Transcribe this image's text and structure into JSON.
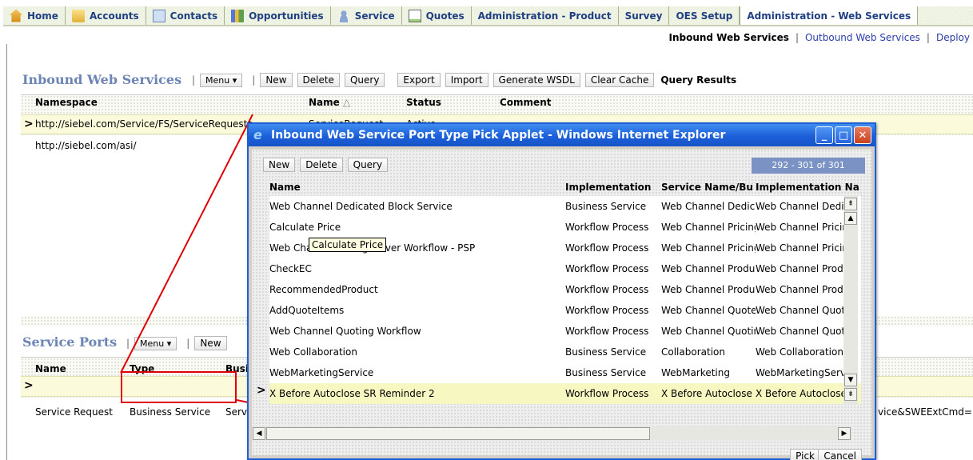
{
  "tabs": [
    {
      "label": "Home",
      "icon": "home-icon"
    },
    {
      "label": "Accounts",
      "icon": "folder-icon"
    },
    {
      "label": "Contacts",
      "icon": "contact-card-icon"
    },
    {
      "label": "Opportunities",
      "icon": "opportunities-icon"
    },
    {
      "label": "Service",
      "icon": "person-icon"
    },
    {
      "label": "Quotes",
      "icon": "document-icon"
    },
    {
      "label": "Administration - Product",
      "icon": ""
    },
    {
      "label": "Survey",
      "icon": ""
    },
    {
      "label": "OES Setup",
      "icon": ""
    },
    {
      "label": "Administration - Web Services",
      "icon": "",
      "active": true
    }
  ],
  "subnav": {
    "active": "Inbound Web Services",
    "outbound": "Outbound Web Services",
    "deploy": "Deploy"
  },
  "inbound": {
    "title": "Inbound Web Services",
    "menu": "Menu ▾",
    "buttons": {
      "new": "New",
      "delete": "Delete",
      "query": "Query",
      "export": "Export",
      "import": "Import",
      "generate": "Generate WSDL",
      "clear": "Clear Cache"
    },
    "query_results": "Query Results",
    "columns": {
      "namespace": "Namespace",
      "name": "Name",
      "status": "Status",
      "comment": "Comment"
    },
    "rows": [
      {
        "namespace": "http://siebel.com/Service/FS/ServiceRequests",
        "name": "ServiceRequest",
        "status": "Active"
      },
      {
        "namespace": "http://siebel.com/asi/",
        "name": "",
        "status": ""
      }
    ]
  },
  "ports": {
    "title": "Service Ports",
    "menu": "Menu ▾",
    "new": "New",
    "columns": {
      "name": "Name",
      "type": "Type",
      "business": "Busi"
    },
    "row": {
      "name": "Service Request",
      "type": "Business Service",
      "serv": "Serv",
      "tail": "vice&SWEExtCmd=E"
    }
  },
  "popup": {
    "title": "Inbound Web Service Port Type Pick Applet - Windows Internet Explorer",
    "buttons": {
      "new": "New",
      "delete": "Delete",
      "query": "Query",
      "pick": "Pick",
      "cancel": "Cancel"
    },
    "pager": "292 - 301 of 301",
    "columns": {
      "name": "Name",
      "implementation": "Implementation",
      "service": "Service Name/Bu",
      "impl_name": "Implementation Na"
    },
    "rows": [
      {
        "name": "Web Channel Dedicated Block Service",
        "impl": "Business Service",
        "svc": "Web Channel Dedica",
        "implname": "Web Channel Dedicate"
      },
      {
        "name": "Calculate Price",
        "impl": "Workflow Process",
        "svc": "Web Channel Pricing",
        "implname": "Web Channel Pricing D"
      },
      {
        "name": "Web Channel Pricing Driver Workflow - PSP",
        "impl": "Workflow Process",
        "svc": "Web Channel Pricing",
        "implname": "Web Channel Pricing D"
      },
      {
        "name": "CheckEC",
        "impl": "Workflow Process",
        "svc": "Web Channel Produ",
        "implname": "Web Channel Product"
      },
      {
        "name": "RecommendedProduct",
        "impl": "Workflow Process",
        "svc": "Web Channel Produ",
        "implname": "Web Channel Product"
      },
      {
        "name": "AddQuoteItems",
        "impl": "Workflow Process",
        "svc": "Web Channel Quote",
        "implname": "Web Channel Quote A"
      },
      {
        "name": "Web Channel Quoting Workflow",
        "impl": "Workflow Process",
        "svc": "Web Channel Quotir",
        "implname": "Web Channel Quoting"
      },
      {
        "name": "Web Collaboration",
        "impl": "Business Service",
        "svc": "Collaboration",
        "implname": "Web Collaboration Ser"
      },
      {
        "name": "WebMarketingService",
        "impl": "Business Service",
        "svc": "WebMarketing",
        "implname": "WebMarketingService"
      },
      {
        "name": "X Before Autoclose SR Reminder 2",
        "impl": "Workflow Process",
        "svc": "X Before Autoclose S",
        "implname": "X Before Autoclose SR"
      }
    ],
    "tooltip": "Calculate Price"
  },
  "colors": {
    "accent": "#1c5fd9",
    "title": "#6d85b5",
    "annotation": "#e00000"
  }
}
